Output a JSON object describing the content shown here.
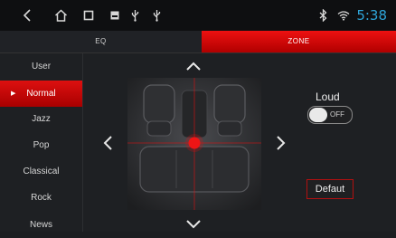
{
  "status_bar": {
    "time": "5:38",
    "icons": [
      "back-icon",
      "home-icon",
      "recent-apps-icon",
      "storage-icon",
      "usb-icon",
      "usb-icon",
      "bluetooth-icon",
      "wifi-icon"
    ]
  },
  "tabs": [
    {
      "label": "EQ",
      "active": false
    },
    {
      "label": "ZONE",
      "active": true
    }
  ],
  "presets": [
    {
      "label": "User",
      "active": false
    },
    {
      "label": "Normal",
      "active": true
    },
    {
      "label": "Jazz",
      "active": false
    },
    {
      "label": "Pop",
      "active": false
    },
    {
      "label": "Classical",
      "active": false
    },
    {
      "label": "Rock",
      "active": false
    },
    {
      "label": "News",
      "active": false
    }
  ],
  "loud": {
    "label": "Loud",
    "state": "OFF"
  },
  "default_button": {
    "label": "Defaut"
  },
  "colors": {
    "accent": "#e01010",
    "clock": "#2ea4d8"
  }
}
